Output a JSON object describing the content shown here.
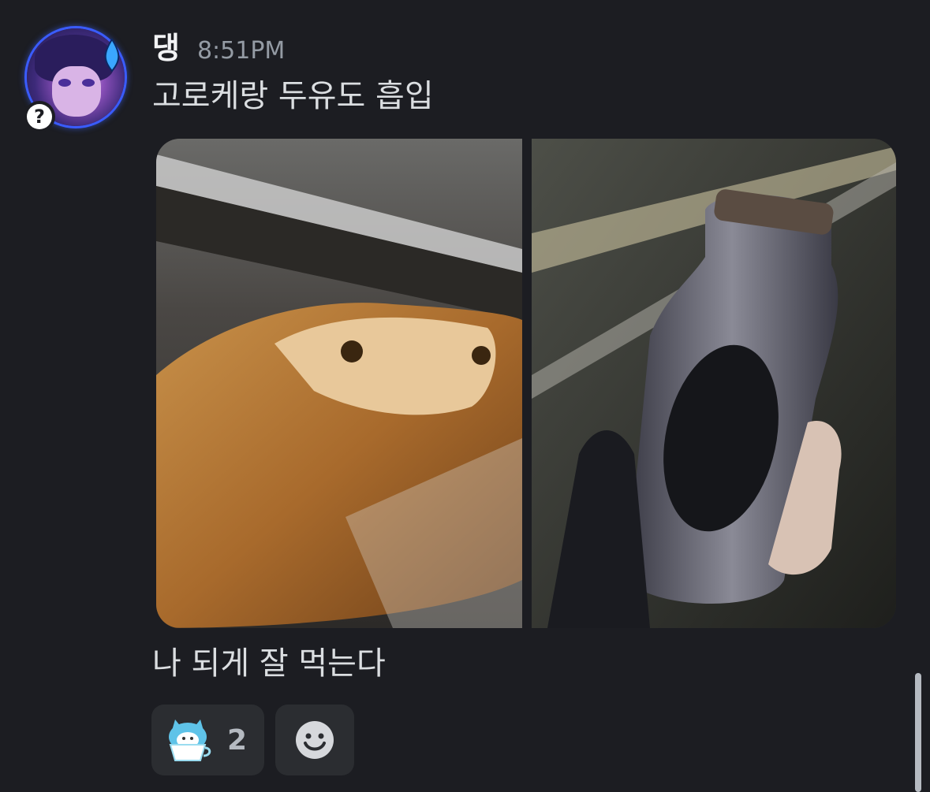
{
  "message": {
    "username": "댕",
    "timestamp": "8:51PM",
    "text": "고로케랑 두유도 흡입",
    "followup_text": "나 되게 잘 먹는다",
    "status_badge": "?",
    "avatar_icon": "anime-character-avatar",
    "sweat_drop_icon": "sweat-drop-icon"
  },
  "attachments": [
    {
      "icon": "croquette-photo"
    },
    {
      "icon": "soy-milk-bottle-photo"
    }
  ],
  "reactions": [
    {
      "icon": "cat-in-teacup-emoji",
      "count": "2"
    },
    {
      "icon": "add-reaction-smiley-icon"
    }
  ],
  "colors": {
    "background": "#1c1d22",
    "reaction_bg": "#2b2d31",
    "timestamp": "#949ba4",
    "text": "#dbdee1"
  }
}
